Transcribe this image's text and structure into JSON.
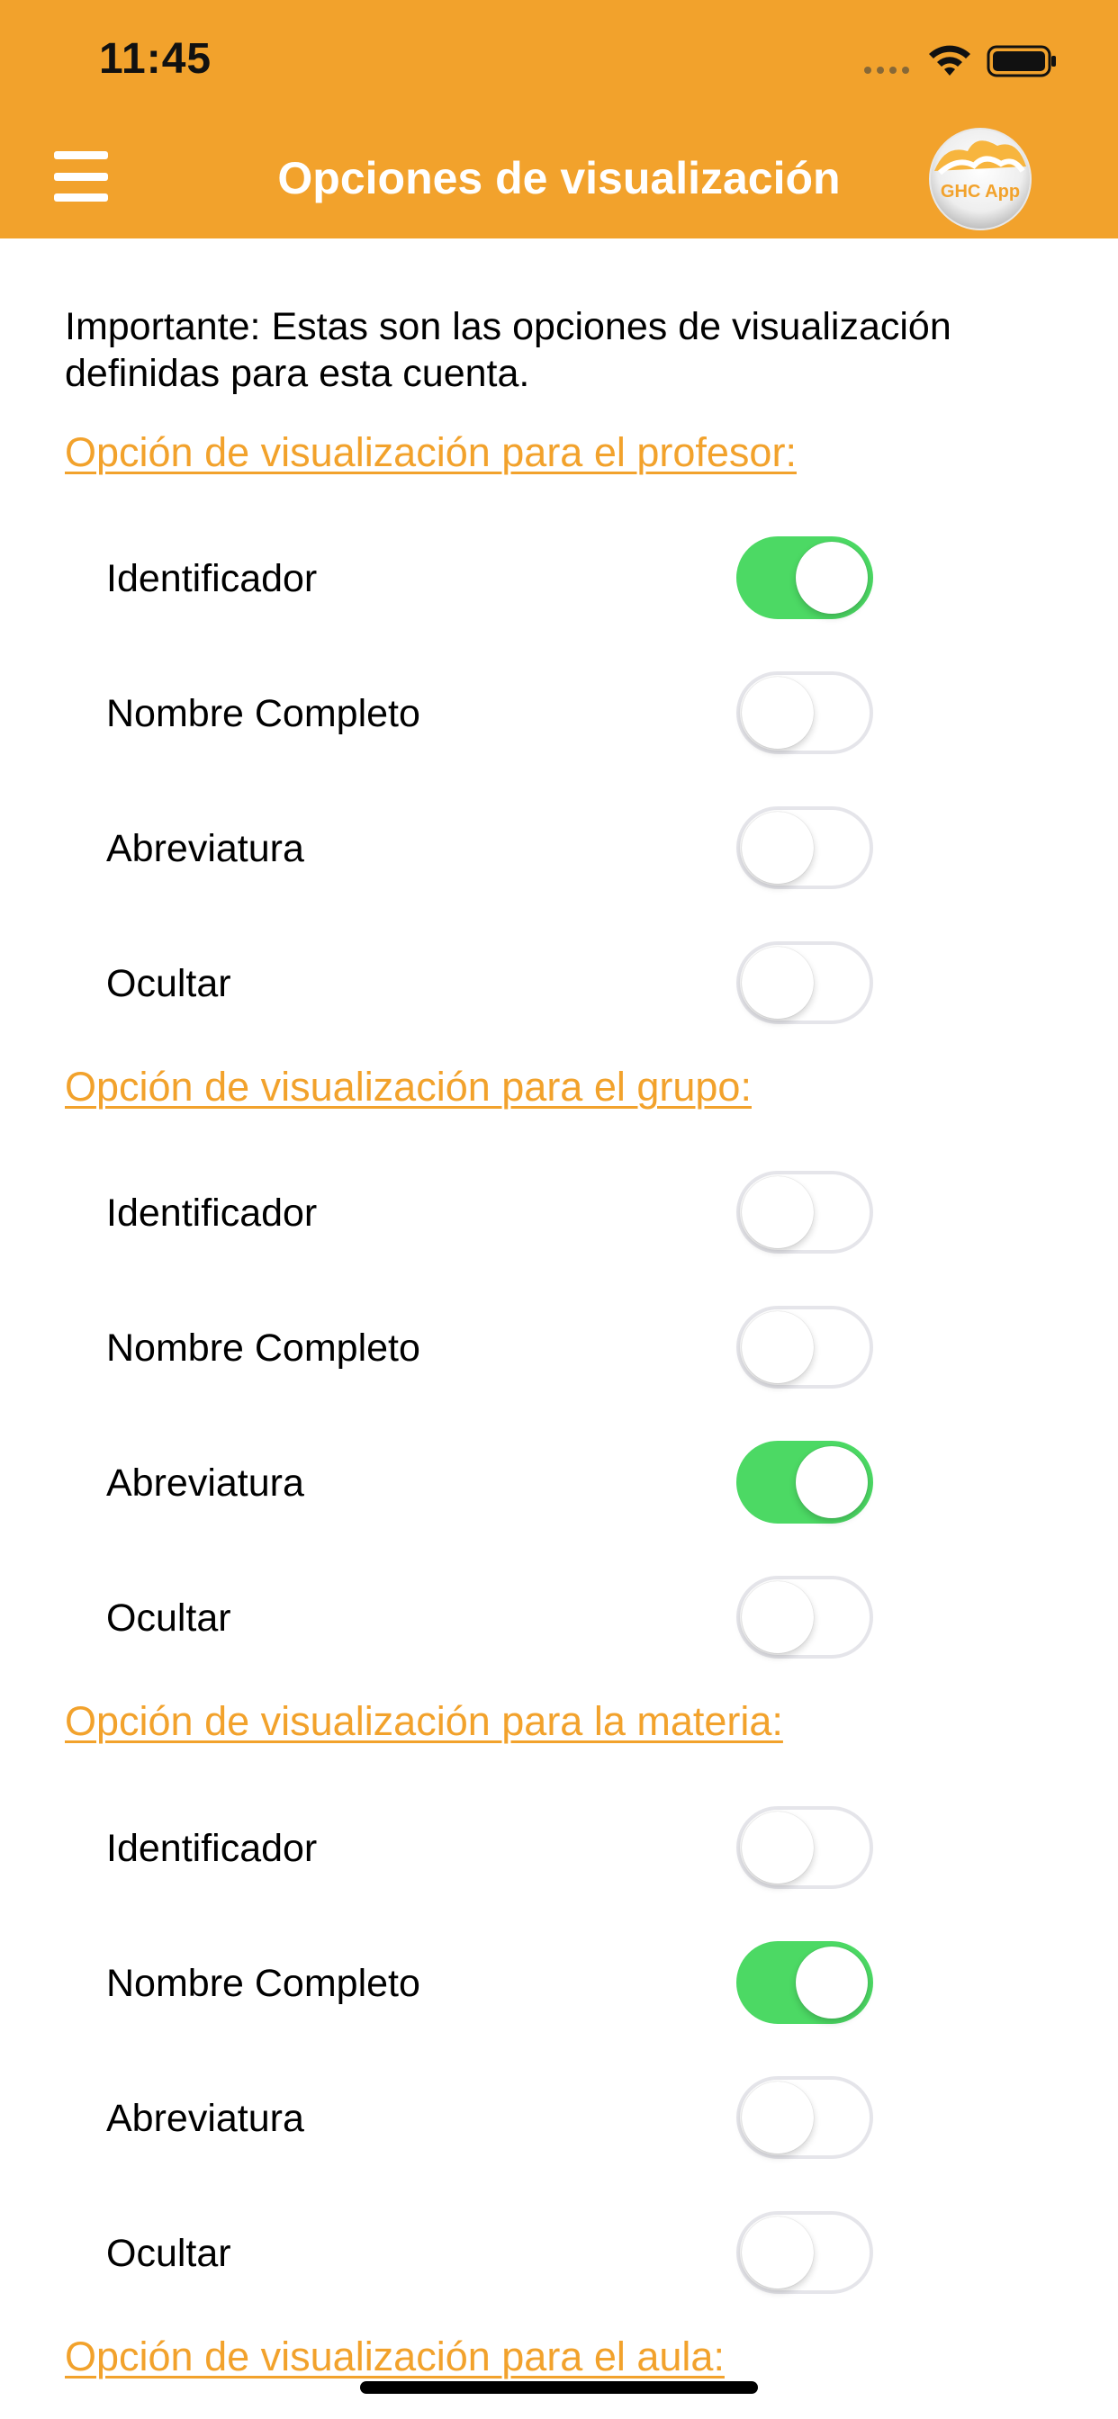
{
  "status_bar": {
    "time": "11:45",
    "icons": [
      "signal-dots-icon",
      "wifi-icon",
      "battery-icon"
    ]
  },
  "header": {
    "title": "Opciones de visualización",
    "logo_text": "GHC App",
    "menu_icon": "hamburger-menu-icon"
  },
  "colors": {
    "accent": "#F2A22C",
    "switch_on": "#4CD964",
    "switch_off_border": "#E5E5EA"
  },
  "intro_text": "Importante: Estas son las opciones de visualización definidas para esta cuenta.",
  "sections": [
    {
      "title": "Opción de visualización para el profesor:",
      "options": [
        {
          "label": "Identificador",
          "on": true
        },
        {
          "label": "Nombre Completo",
          "on": false
        },
        {
          "label": "Abreviatura",
          "on": false
        },
        {
          "label": "Ocultar",
          "on": false
        }
      ]
    },
    {
      "title": "Opción de visualización para el grupo:",
      "options": [
        {
          "label": "Identificador",
          "on": false
        },
        {
          "label": "Nombre Completo",
          "on": false
        },
        {
          "label": "Abreviatura",
          "on": true
        },
        {
          "label": "Ocultar",
          "on": false
        }
      ]
    },
    {
      "title": "Opción de visualización para la materia:",
      "options": [
        {
          "label": "Identificador",
          "on": false
        },
        {
          "label": "Nombre Completo",
          "on": true
        },
        {
          "label": "Abreviatura",
          "on": false
        },
        {
          "label": "Ocultar",
          "on": false
        }
      ]
    },
    {
      "title": "Opción de visualización para el aula:",
      "options": []
    }
  ]
}
